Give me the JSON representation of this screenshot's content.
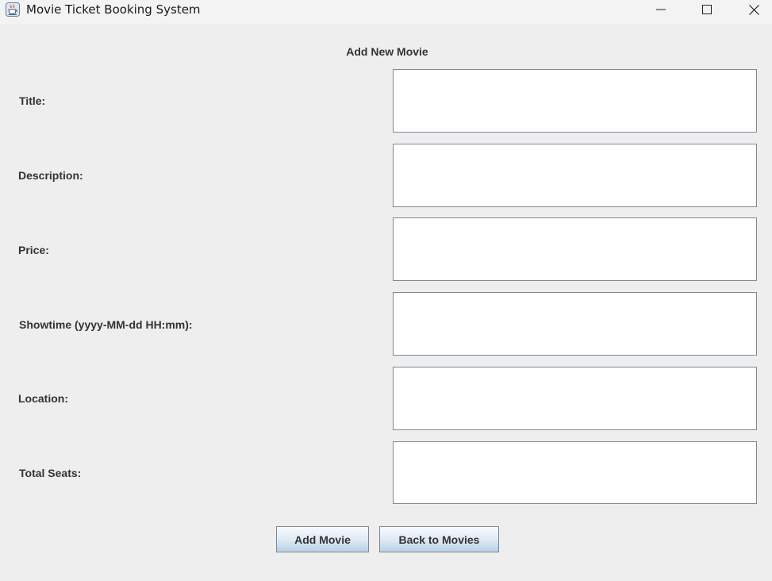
{
  "window": {
    "title": "Movie Ticket Booking System"
  },
  "form": {
    "heading": "Add New Movie",
    "fields": [
      {
        "label": "Title:",
        "value": ""
      },
      {
        "label": "Description:",
        "value": ""
      },
      {
        "label": "Price:",
        "value": ""
      },
      {
        "label": "Showtime (yyyy-MM-dd HH:mm):",
        "value": ""
      },
      {
        "label": "Location:",
        "value": ""
      },
      {
        "label": "Total Seats:",
        "value": ""
      }
    ]
  },
  "buttons": {
    "add_label": "Add Movie",
    "back_label": "Back to Movies"
  },
  "colors": {
    "background": "#eeeeee",
    "input_border": "#7a8a99",
    "label_text": "#333333"
  },
  "icons": [
    "java-cup-icon",
    "minimize-icon",
    "maximize-icon",
    "close-icon"
  ]
}
